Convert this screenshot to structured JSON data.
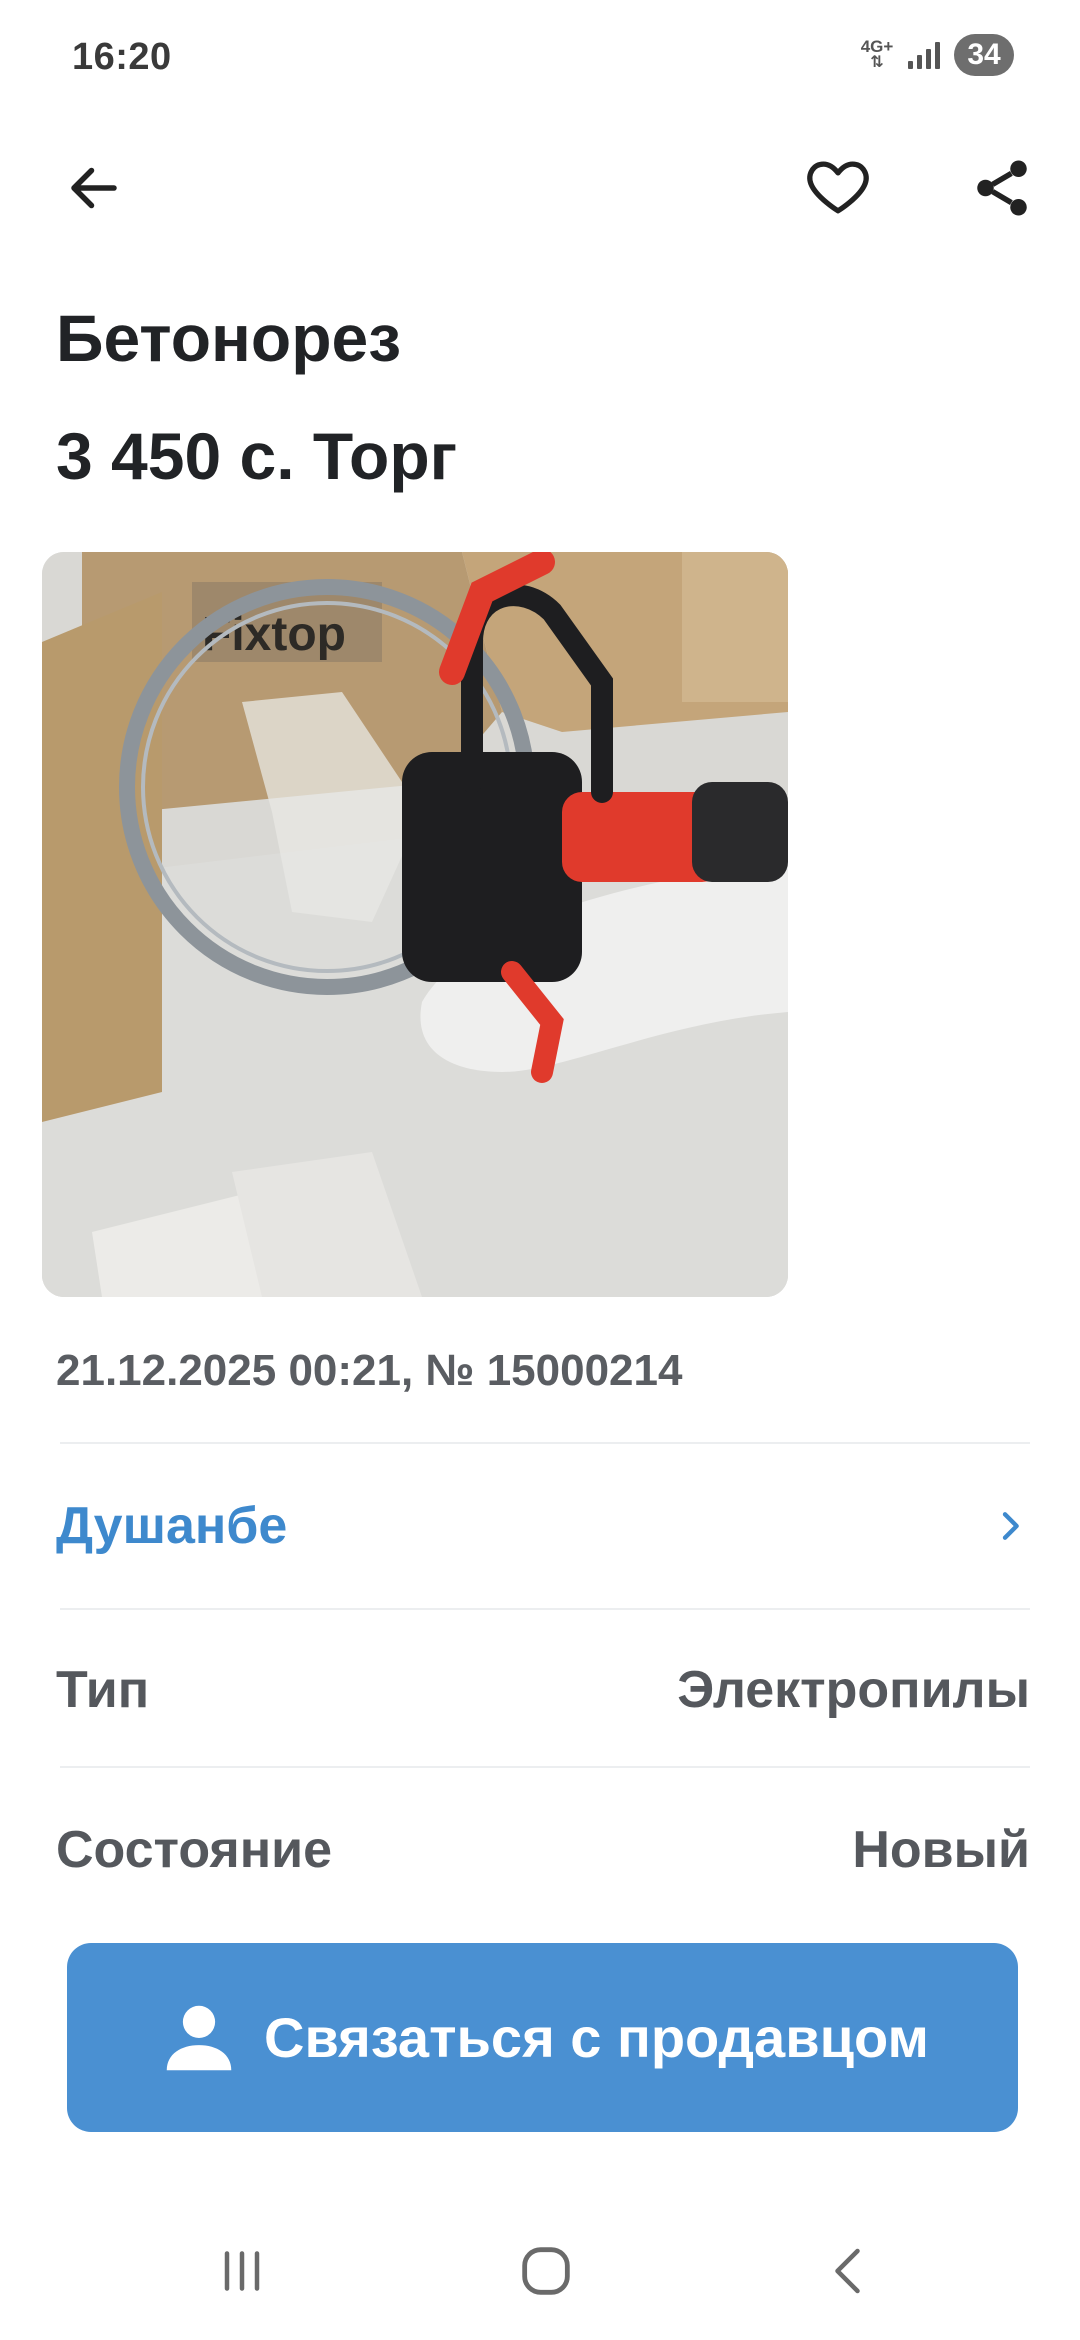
{
  "status_bar": {
    "time": "16:20",
    "network": "4G+",
    "battery": "34"
  },
  "toolbar": {
    "back_icon": "arrow-left-icon",
    "favorite_icon": "heart-outline-icon",
    "share_icon": "share-icon"
  },
  "listing": {
    "title": "Бетонорез",
    "price": "3 450 с. Торг",
    "meta": "21.12.2025 00:21, № 15000214",
    "photo_text": "Fixtop"
  },
  "location": {
    "city": "Душанбе"
  },
  "attributes": [
    {
      "label": "Тип",
      "value": "Электропилы"
    },
    {
      "label": "Состояние",
      "value": "Новый"
    }
  ],
  "contact": {
    "label": "Связаться с продавцом",
    "icon": "person-icon"
  },
  "navigation": {
    "recents_icon": "recents-icon",
    "home_icon": "home-icon",
    "back_icon": "nav-back-icon"
  },
  "colors": {
    "accent": "#4a90d2",
    "link": "#3e89cd",
    "text": "#212326",
    "secondary_text": "#55585d"
  }
}
